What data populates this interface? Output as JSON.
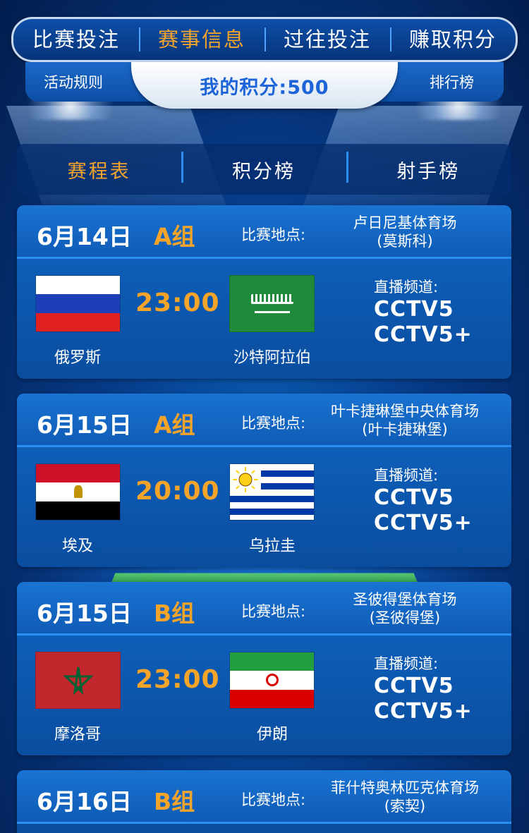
{
  "colors": {
    "accent": "#f5a42a",
    "brand_blue": "#0d4fa8",
    "points_text": "#1c64d8"
  },
  "topnav": {
    "tabs": [
      {
        "label": "比赛投注",
        "active": false
      },
      {
        "label": "赛事信息",
        "active": true
      },
      {
        "label": "过往投注",
        "active": false
      },
      {
        "label": "赚取积分",
        "active": false
      }
    ]
  },
  "subbar": {
    "rules_label": "活动规则",
    "points_text": "我的积分:500",
    "ranking_label": "排行榜"
  },
  "subtabs": [
    {
      "label": "赛程表",
      "active": true
    },
    {
      "label": "积分榜",
      "active": false
    },
    {
      "label": "射手榜",
      "active": false
    }
  ],
  "matches": [
    {
      "date": "6月14日",
      "group": "A组",
      "venue_label": "比赛地点:",
      "venue_line1": "卢日尼基体育场",
      "venue_line2": "(莫斯科)",
      "home": "俄罗斯",
      "away": "沙特阿拉伯",
      "home_flag": "russia-flag-icon",
      "away_flag": "saudi-arabia-flag-icon",
      "time": "23:00",
      "channel_label": "直播频道:",
      "channels": [
        "CCTV5",
        "CCTV5+"
      ]
    },
    {
      "date": "6月15日",
      "group": "A组",
      "venue_label": "比赛地点:",
      "venue_line1": "叶卡捷琳堡中央体育场",
      "venue_line2": "(叶卡捷琳堡)",
      "home": "埃及",
      "away": "乌拉圭",
      "home_flag": "egypt-flag-icon",
      "away_flag": "uruguay-flag-icon",
      "time": "20:00",
      "channel_label": "直播频道:",
      "channels": [
        "CCTV5",
        "CCTV5+"
      ]
    },
    {
      "date": "6月15日",
      "group": "B组",
      "venue_label": "比赛地点:",
      "venue_line1": "圣彼得堡体育场",
      "venue_line2": "(圣彼得堡)",
      "home": "摩洛哥",
      "away": "伊朗",
      "home_flag": "morocco-flag-icon",
      "away_flag": "iran-flag-icon",
      "time": "23:00",
      "channel_label": "直播频道:",
      "channels": [
        "CCTV5",
        "CCTV5+"
      ]
    },
    {
      "date": "6月16日",
      "group": "B组",
      "venue_label": "比赛地点:",
      "venue_line1": "菲什特奥林匹克体育场",
      "venue_line2": "(索契)"
    }
  ]
}
